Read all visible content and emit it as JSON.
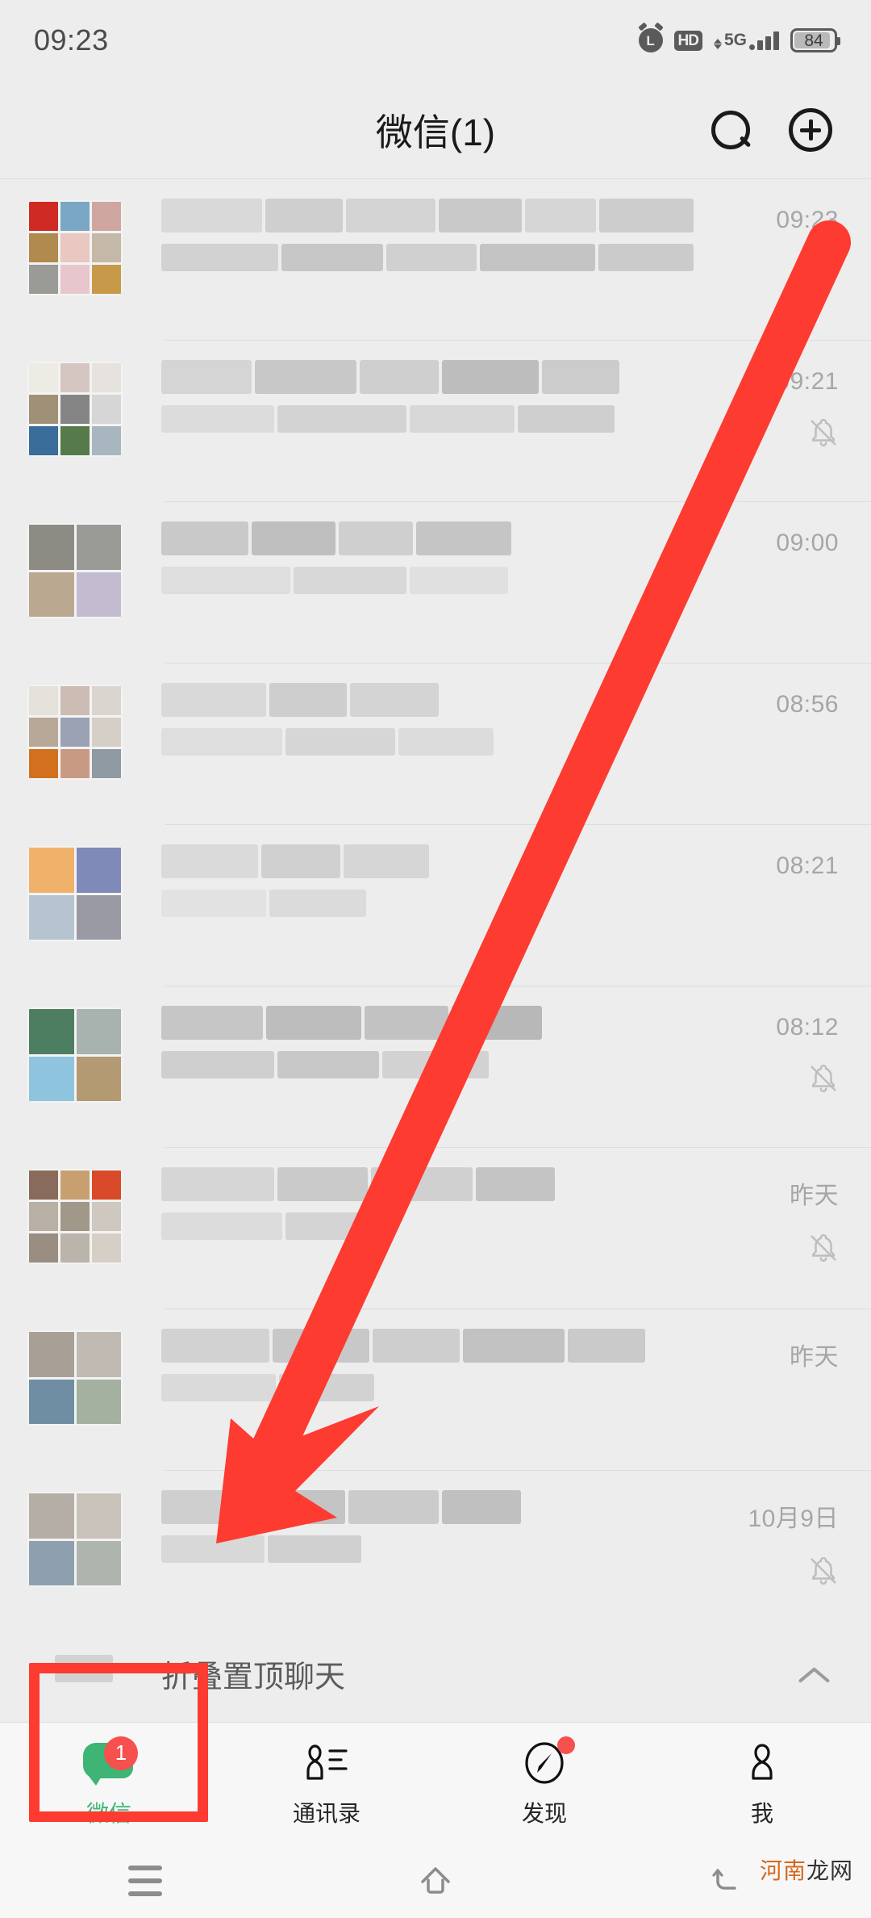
{
  "statusbar": {
    "time": "09:23",
    "icons": [
      "alarm-icon",
      "hd-icon",
      "5g-signal-icon",
      "battery-icon"
    ],
    "alarm_glyph": "L",
    "hd_label": "HD",
    "network_label": "5G",
    "battery_level": "84"
  },
  "header": {
    "title": "微信(1)",
    "search_icon": "search-icon",
    "add_icon": "plus-circle-icon"
  },
  "chat_list": {
    "rows": [
      {
        "timestamp": "09:23",
        "muted": false,
        "avatar_type": "grid-9",
        "has_draft_indicator": true
      },
      {
        "timestamp": "09:21",
        "muted": true,
        "avatar_type": "grid-9",
        "has_draft_indicator": false
      },
      {
        "timestamp": "09:00",
        "muted": false,
        "avatar_type": "grid-4",
        "has_draft_indicator": false
      },
      {
        "timestamp": "08:56",
        "muted": false,
        "avatar_type": "grid-9",
        "has_draft_indicator": false
      },
      {
        "timestamp": "08:21",
        "muted": false,
        "avatar_type": "grid-4",
        "has_draft_indicator": false
      },
      {
        "timestamp": "08:12",
        "muted": true,
        "avatar_type": "grid-4",
        "has_draft_indicator": false
      },
      {
        "timestamp": "昨天",
        "muted": true,
        "avatar_type": "grid-9",
        "has_draft_indicator": false
      },
      {
        "timestamp": "昨天",
        "muted": false,
        "avatar_type": "grid-4",
        "has_draft_indicator": false
      },
      {
        "timestamp": "10月9日",
        "muted": true,
        "avatar_type": "grid-4",
        "has_draft_indicator": false
      }
    ]
  },
  "fold_row": {
    "label": "折叠置顶聊天",
    "chevron_icon": "chevron-up-icon"
  },
  "tabbar": {
    "tabs": [
      {
        "label": "微信",
        "icon": "chat-bubble-icon",
        "active": true,
        "badge": "1",
        "dot": false
      },
      {
        "label": "通讯录",
        "icon": "contacts-icon",
        "active": false,
        "badge": null,
        "dot": false
      },
      {
        "label": "发现",
        "icon": "compass-icon",
        "active": false,
        "badge": null,
        "dot": true
      },
      {
        "label": "我",
        "icon": "person-icon",
        "active": false,
        "badge": null,
        "dot": false
      }
    ],
    "active_color": "#3eb575",
    "badge_color": "#f6504f"
  },
  "android_nav": {
    "buttons": [
      {
        "name": "menu-icon"
      },
      {
        "name": "home-icon"
      },
      {
        "name": "back-icon"
      }
    ]
  },
  "annotations": {
    "arrow_color": "#fd3b30",
    "rect_color": "#fd3b30"
  },
  "watermark": {
    "part1": "河南",
    "part2": "龙网"
  }
}
